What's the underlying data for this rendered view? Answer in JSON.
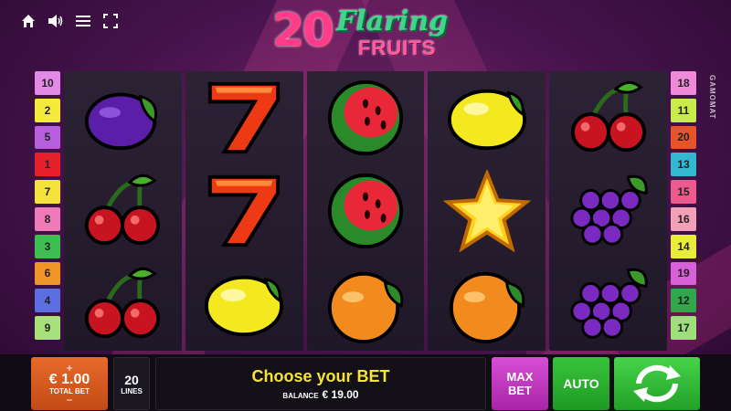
{
  "toolbar": {
    "icons": [
      "home-icon",
      "speaker-icon",
      "menu-icon",
      "fullscreen-icon"
    ]
  },
  "logo": {
    "number": "20",
    "word1": "Flaring",
    "word2": "FRUITS"
  },
  "provider": "GAMOMAT",
  "paylines_left": [
    {
      "n": "10",
      "color": "#e38ae6"
    },
    {
      "n": "2",
      "color": "#f6ea3a"
    },
    {
      "n": "5",
      "color": "#b85fe0"
    },
    {
      "n": "1",
      "color": "#e8202c"
    },
    {
      "n": "7",
      "color": "#f5e23a"
    },
    {
      "n": "8",
      "color": "#ef7ab8"
    },
    {
      "n": "3",
      "color": "#3ebd52"
    },
    {
      "n": "6",
      "color": "#f09428"
    },
    {
      "n": "4",
      "color": "#5c6ee0"
    },
    {
      "n": "9",
      "color": "#a8e07a"
    }
  ],
  "paylines_right": [
    {
      "n": "18",
      "color": "#f08ad8"
    },
    {
      "n": "11",
      "color": "#c8ec4a"
    },
    {
      "n": "20",
      "color": "#e8542a"
    },
    {
      "n": "13",
      "color": "#32b8d0"
    },
    {
      "n": "15",
      "color": "#ee5a8e"
    },
    {
      "n": "16",
      "color": "#f2a0b8"
    },
    {
      "n": "14",
      "color": "#e8ec3a"
    },
    {
      "n": "19",
      "color": "#d860d8"
    },
    {
      "n": "12",
      "color": "#2ea84a"
    },
    {
      "n": "17",
      "color": "#9de07a"
    }
  ],
  "reels": [
    [
      "plum",
      "cherry",
      "cherry"
    ],
    [
      "seven",
      "seven",
      "lemon"
    ],
    [
      "watermelon",
      "watermelon",
      "orange"
    ],
    [
      "lemon",
      "star",
      "orange"
    ],
    [
      "cherry",
      "grapes",
      "grapes"
    ]
  ],
  "bet": {
    "plus": "+",
    "amount": "€ 1.00",
    "label": "TOTAL BET",
    "minus": "−"
  },
  "lines": {
    "count": "20",
    "label": "LINES"
  },
  "message": {
    "text": "Choose your BET",
    "balance_label": "BALANCE",
    "balance_value": "€ 19.00"
  },
  "buttons": {
    "max_bet": "MAX BET",
    "auto": "AUTO"
  }
}
